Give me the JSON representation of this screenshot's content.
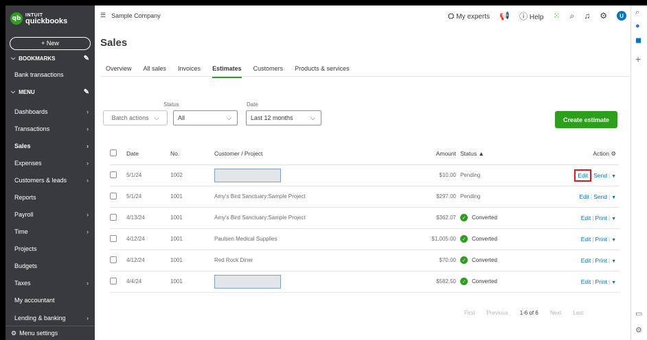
{
  "app": {
    "logo_top": "INTUIT",
    "logo_bottom": "quickbooks",
    "logo_badge": "qb"
  },
  "sidebar": {
    "new_label": "+ New",
    "bookmarks_label": "BOOKMARKS",
    "bookmark_items": [
      {
        "label": "Bank transactions"
      }
    ],
    "menu_label": "MENU",
    "items": [
      {
        "label": "Dashboards",
        "chevron": true
      },
      {
        "label": "Transactions",
        "chevron": true
      },
      {
        "label": "Sales",
        "chevron": true,
        "active": true
      },
      {
        "label": "Expenses",
        "chevron": true
      },
      {
        "label": "Customers & leads",
        "chevron": true
      },
      {
        "label": "Reports",
        "chevron": false
      },
      {
        "label": "Payroll",
        "chevron": true
      },
      {
        "label": "Time",
        "chevron": true
      },
      {
        "label": "Projects",
        "chevron": false
      },
      {
        "label": "Budgets",
        "chevron": false
      },
      {
        "label": "Taxes",
        "chevron": true
      },
      {
        "label": "My accountant",
        "chevron": false
      },
      {
        "label": "Lending & banking",
        "chevron": true
      }
    ],
    "settings_label": "Menu settings"
  },
  "topbar": {
    "company": "Sample Company",
    "experts": "My experts",
    "help": "Help",
    "avatar_letter": "U"
  },
  "page": {
    "title": "Sales",
    "tabs": [
      {
        "label": "Overview",
        "active": false
      },
      {
        "label": "All sales",
        "active": false
      },
      {
        "label": "Invoices",
        "active": false
      },
      {
        "label": "Estimates",
        "active": true
      },
      {
        "label": "Customers",
        "active": false
      },
      {
        "label": "Products & services",
        "active": false
      }
    ]
  },
  "filters": {
    "batch_label": "Batch actions",
    "status_label": "Status",
    "status_value": "All",
    "date_label": "Date",
    "date_value": "Last 12 months",
    "create_label": "Create estimate"
  },
  "table": {
    "headers": {
      "date": "Date",
      "no": "No.",
      "customer": "Customer / Project",
      "amount": "Amount",
      "status": "Status ▲",
      "action": "Action"
    },
    "rows": [
      {
        "date": "5/1/24",
        "no": "1002",
        "customer": "",
        "redacted": true,
        "amount": "$10.00",
        "status": "Pending",
        "converted": false,
        "a1": "Edit",
        "a2": "Send",
        "highlight": true
      },
      {
        "date": "5/1/24",
        "no": "1001",
        "customer": "Amy's Bird Sanctuary:Sample Project",
        "redacted": false,
        "amount": "$297.00",
        "status": "Pending",
        "converted": false,
        "a1": "Edit",
        "a2": "Send",
        "highlight": false
      },
      {
        "date": "4/13/24",
        "no": "1001",
        "customer": "Amy's Bird Sanctuary:Sample Project",
        "redacted": false,
        "amount": "$362.07",
        "status": "Converted",
        "converted": true,
        "a1": "Edit",
        "a2": "Print",
        "highlight": false
      },
      {
        "date": "4/12/24",
        "no": "1001",
        "customer": "Paulsen Medical Supplies",
        "redacted": false,
        "amount": "$1,005.00",
        "status": "Converted",
        "converted": true,
        "a1": "Edit",
        "a2": "Print",
        "highlight": false
      },
      {
        "date": "4/12/24",
        "no": "1001",
        "customer": "Red Rock Diner",
        "redacted": false,
        "amount": "$70.00",
        "status": "Converted",
        "converted": true,
        "a1": "Edit",
        "a2": "Print",
        "highlight": false
      },
      {
        "date": "4/4/24",
        "no": "1001",
        "customer": "",
        "redacted": true,
        "amount": "$582.50",
        "status": "Converted",
        "converted": true,
        "a1": "Edit",
        "a2": "Print",
        "highlight": false
      }
    ]
  },
  "pager": {
    "first": "First",
    "previous": "Previous",
    "range": "1-6 of 6",
    "next": "Next",
    "last": "Last"
  },
  "colors": {
    "brand_green": "#2ca01c",
    "sidebar_bg": "#393a3d",
    "link_blue": "#0077c5",
    "highlight_red": "#e3161c"
  }
}
